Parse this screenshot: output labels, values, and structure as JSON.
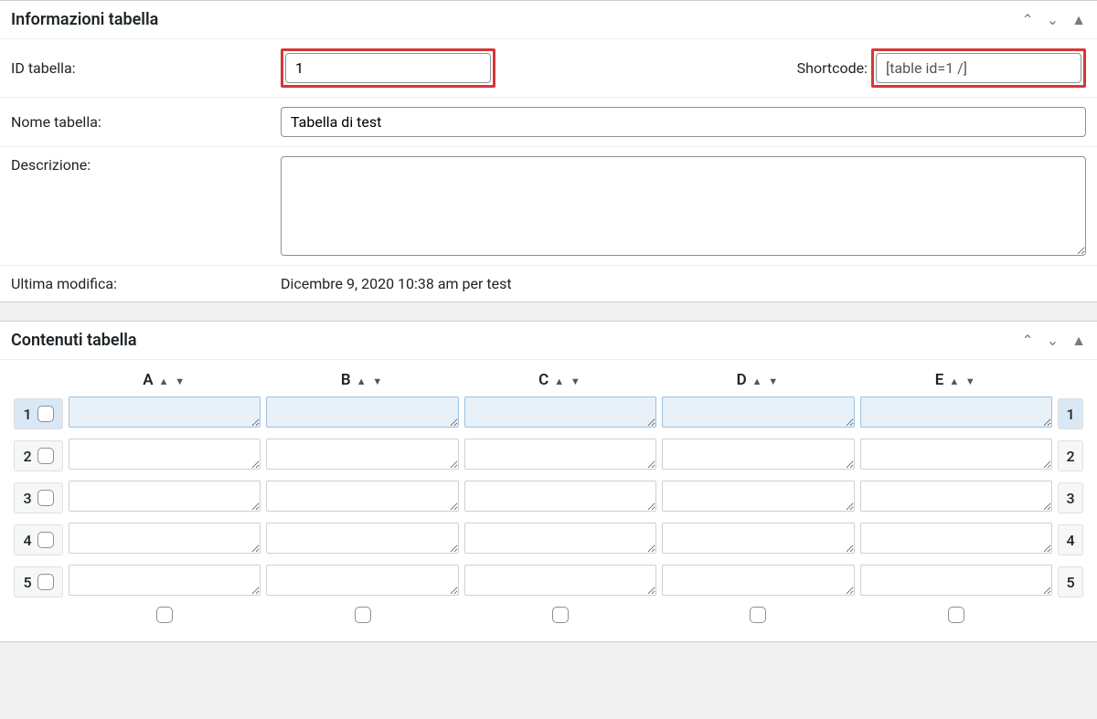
{
  "info_panel": {
    "title": "Informazioni tabella",
    "id_label": "ID tabella:",
    "id_value": "1",
    "shortcode_label": "Shortcode:",
    "shortcode_value": "[table id=1 /]",
    "name_label": "Nome tabella:",
    "name_value": "Tabella di test",
    "desc_label": "Descrizione:",
    "desc_value": "",
    "modified_label": "Ultima modifica:",
    "modified_value": "Dicembre 9, 2020 10:38 am per test"
  },
  "content_panel": {
    "title": "Contenuti tabella",
    "columns": [
      "A",
      "B",
      "C",
      "D",
      "E"
    ],
    "rows": [
      {
        "num": "1",
        "selected": true,
        "cells": [
          "",
          "",
          "",
          "",
          ""
        ]
      },
      {
        "num": "2",
        "selected": false,
        "cells": [
          "",
          "",
          "",
          "",
          ""
        ]
      },
      {
        "num": "3",
        "selected": false,
        "cells": [
          "",
          "",
          "",
          "",
          ""
        ]
      },
      {
        "num": "4",
        "selected": false,
        "cells": [
          "",
          "",
          "",
          "",
          ""
        ]
      },
      {
        "num": "5",
        "selected": false,
        "cells": [
          "",
          "",
          "",
          "",
          ""
        ]
      }
    ]
  },
  "icons": {
    "up": "⌃",
    "down": "⌄",
    "collapse": "▲",
    "sort_up": "▲",
    "sort_down": "▼"
  }
}
